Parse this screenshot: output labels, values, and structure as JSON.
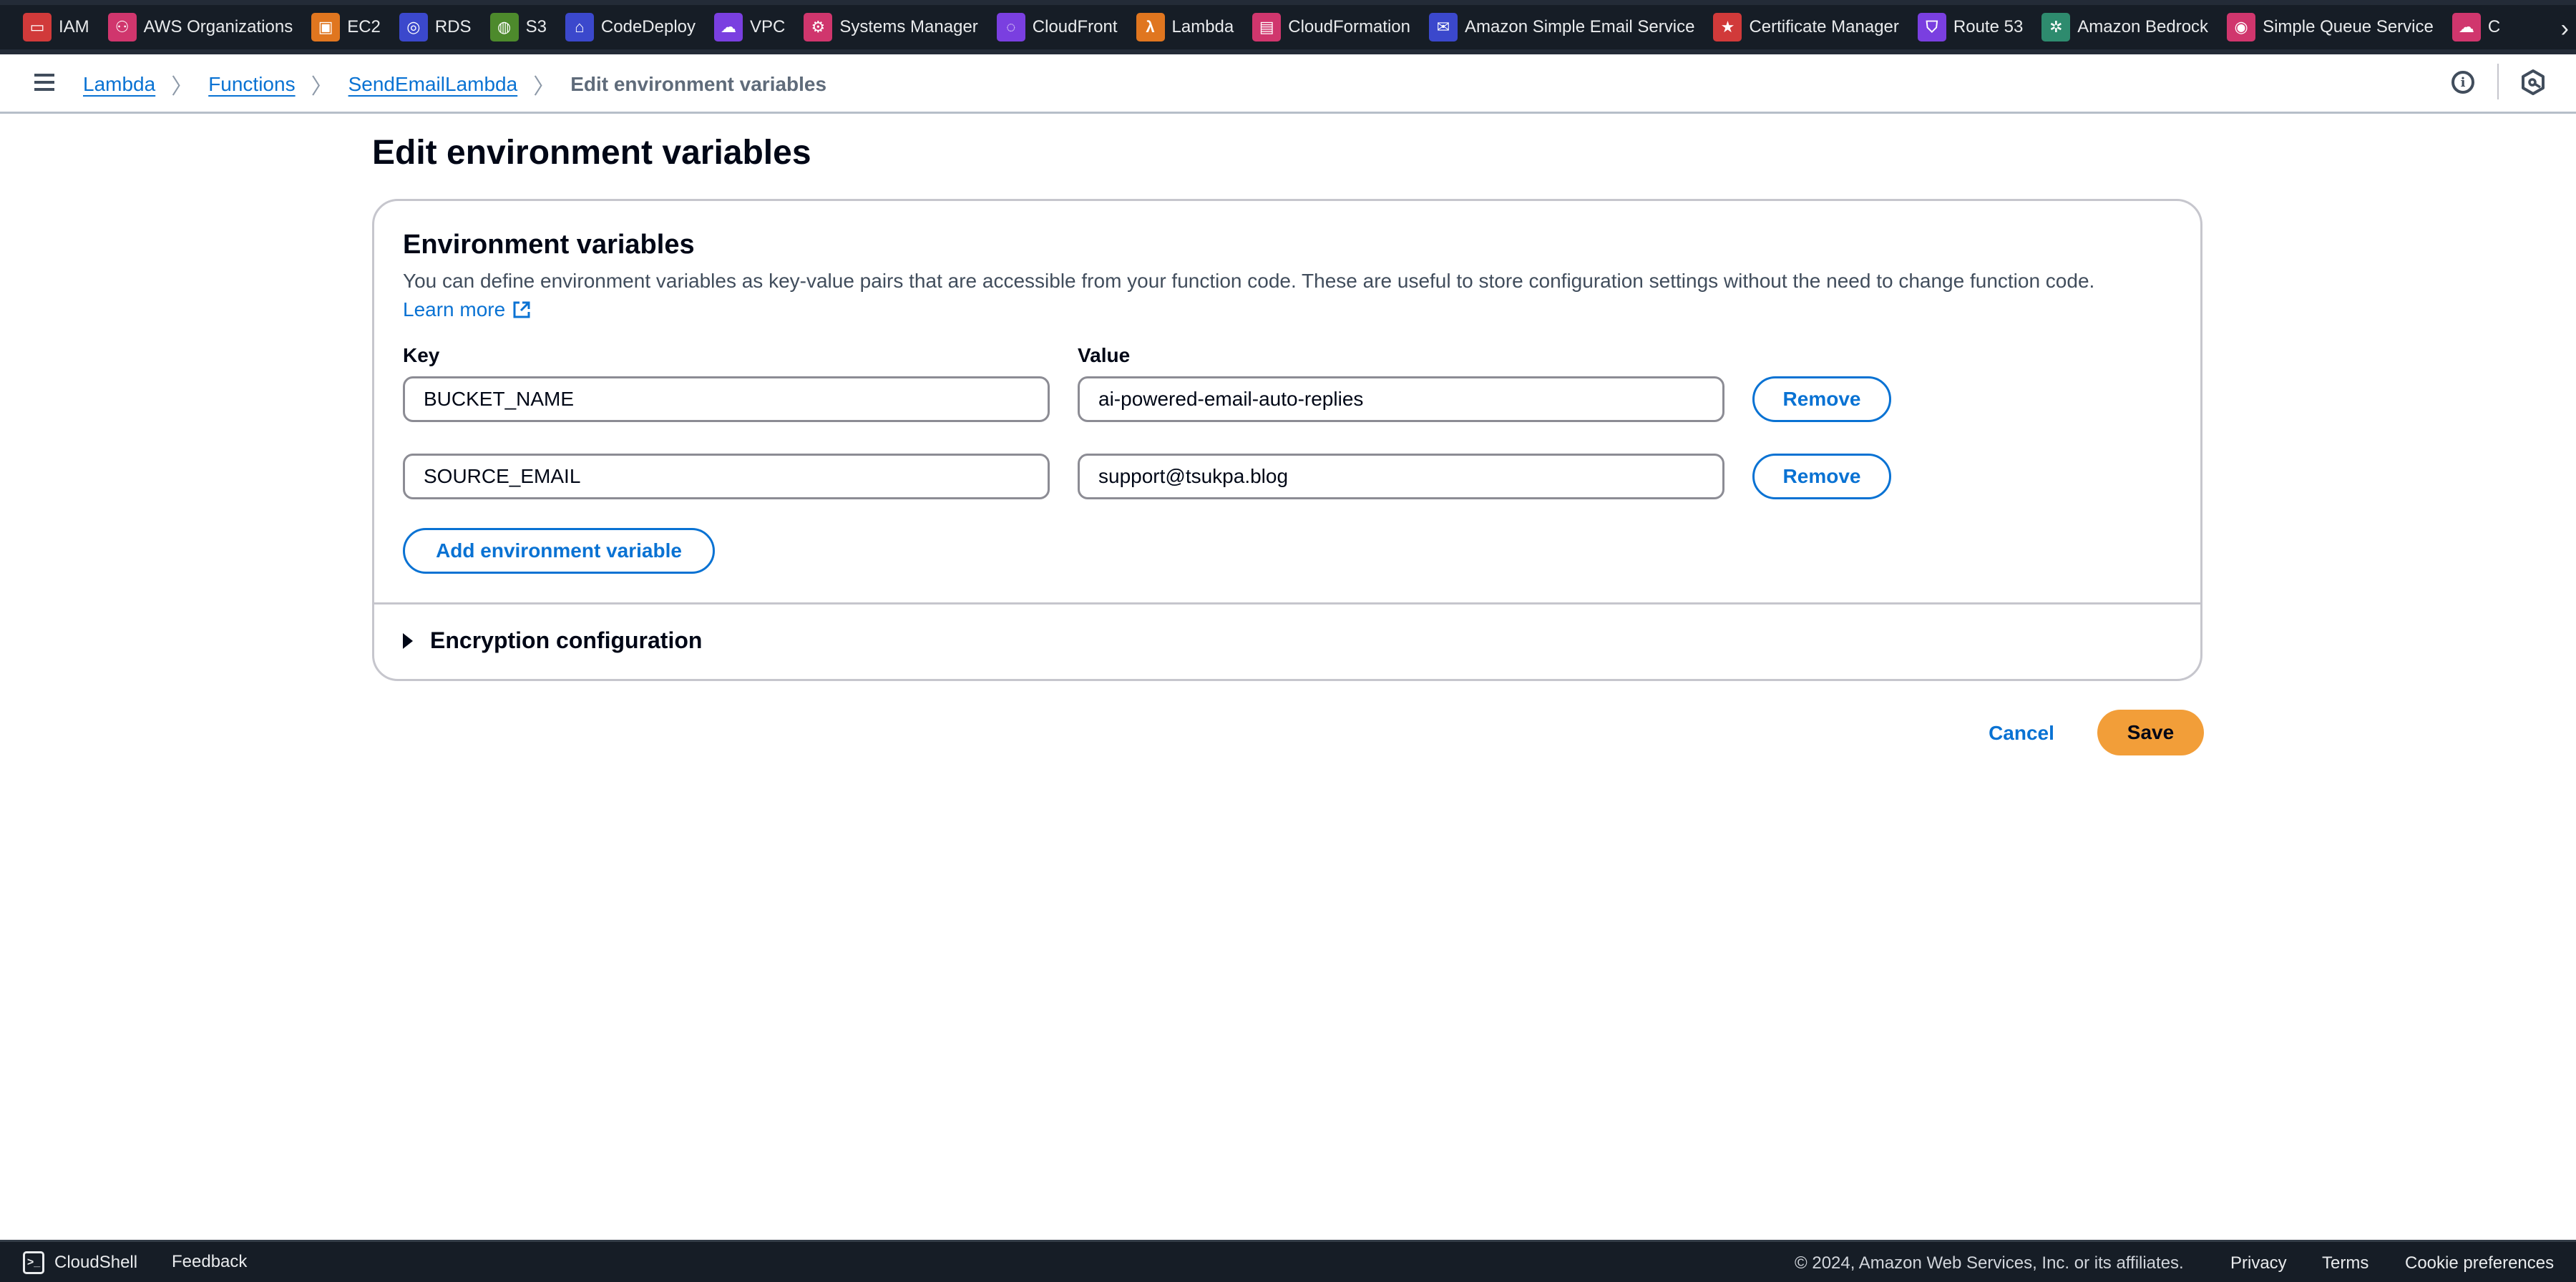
{
  "services_bar": {
    "items": [
      {
        "label": "IAM",
        "icon": "iam-icon",
        "color": "#d13a3a",
        "glyph": "▭"
      },
      {
        "label": "AWS Organizations",
        "icon": "organizations-icon",
        "color": "#d0366d",
        "glyph": "⚇"
      },
      {
        "label": "EC2",
        "icon": "ec2-icon",
        "color": "#e0761f",
        "glyph": "▣"
      },
      {
        "label": "RDS",
        "icon": "rds-icon",
        "color": "#3b48cc",
        "glyph": "◎"
      },
      {
        "label": "S3",
        "icon": "s3-icon",
        "color": "#4d8a2c",
        "glyph": "◍"
      },
      {
        "label": "CodeDeploy",
        "icon": "codedeploy-icon",
        "color": "#3b48cc",
        "glyph": "⌂"
      },
      {
        "label": "VPC",
        "icon": "vpc-icon",
        "color": "#7a3fe0",
        "glyph": "☁"
      },
      {
        "label": "Systems Manager",
        "icon": "systems-manager-icon",
        "color": "#d0366d",
        "glyph": "⚙"
      },
      {
        "label": "CloudFront",
        "icon": "cloudfront-icon",
        "color": "#7a3fe0",
        "glyph": "◌"
      },
      {
        "label": "Lambda",
        "icon": "lambda-icon",
        "color": "#e0761f",
        "glyph": "λ"
      },
      {
        "label": "CloudFormation",
        "icon": "cloudformation-icon",
        "color": "#d0366d",
        "glyph": "▤"
      },
      {
        "label": "Amazon Simple Email Service",
        "icon": "ses-icon",
        "color": "#3b48cc",
        "glyph": "✉"
      },
      {
        "label": "Certificate Manager",
        "icon": "certificate-manager-icon",
        "color": "#d13a3a",
        "glyph": "★"
      },
      {
        "label": "Route 53",
        "icon": "route53-icon",
        "color": "#7a3fe0",
        "glyph": "⛉"
      },
      {
        "label": "Amazon Bedrock",
        "icon": "bedrock-icon",
        "color": "#2e8b6e",
        "glyph": "✲"
      },
      {
        "label": "Simple Queue Service",
        "icon": "sqs-icon",
        "color": "#d0366d",
        "glyph": "◉"
      },
      {
        "label": "C",
        "icon": "cloudwatch-icon",
        "color": "#d0366d",
        "glyph": "☁"
      }
    ],
    "more_icon": "chevron-right-icon"
  },
  "breadcrumb": {
    "items": [
      "Lambda",
      "Functions",
      "SendEmailLambda"
    ],
    "current": "Edit environment variables"
  },
  "page": {
    "title": "Edit environment variables"
  },
  "card": {
    "title": "Environment variables",
    "description": "You can define environment variables as key-value pairs that are accessible from your function code. These are useful to store configuration settings without the need to change function code.",
    "learn_more": "Learn more",
    "key_label": "Key",
    "value_label": "Value",
    "variables": [
      {
        "key": "BUCKET_NAME",
        "value": "ai-powered-email-auto-replies",
        "remove_label": "Remove"
      },
      {
        "key": "SOURCE_EMAIL",
        "value": "support@tsukpa.blog",
        "remove_label": "Remove"
      }
    ],
    "add_label": "Add environment variable",
    "encryption_label": "Encryption configuration"
  },
  "actions": {
    "cancel_label": "Cancel",
    "save_label": "Save"
  },
  "footer": {
    "cloudshell_label": "CloudShell",
    "feedback_label": "Feedback",
    "copyright": "© 2024, Amazon Web Services, Inc. or its affiliates.",
    "privacy": "Privacy",
    "terms": "Terms",
    "cookie_preferences": "Cookie preferences"
  },
  "colors": {
    "link": "#0972d3",
    "primary_button": "#f29e39",
    "nav_bg": "#161d26"
  }
}
